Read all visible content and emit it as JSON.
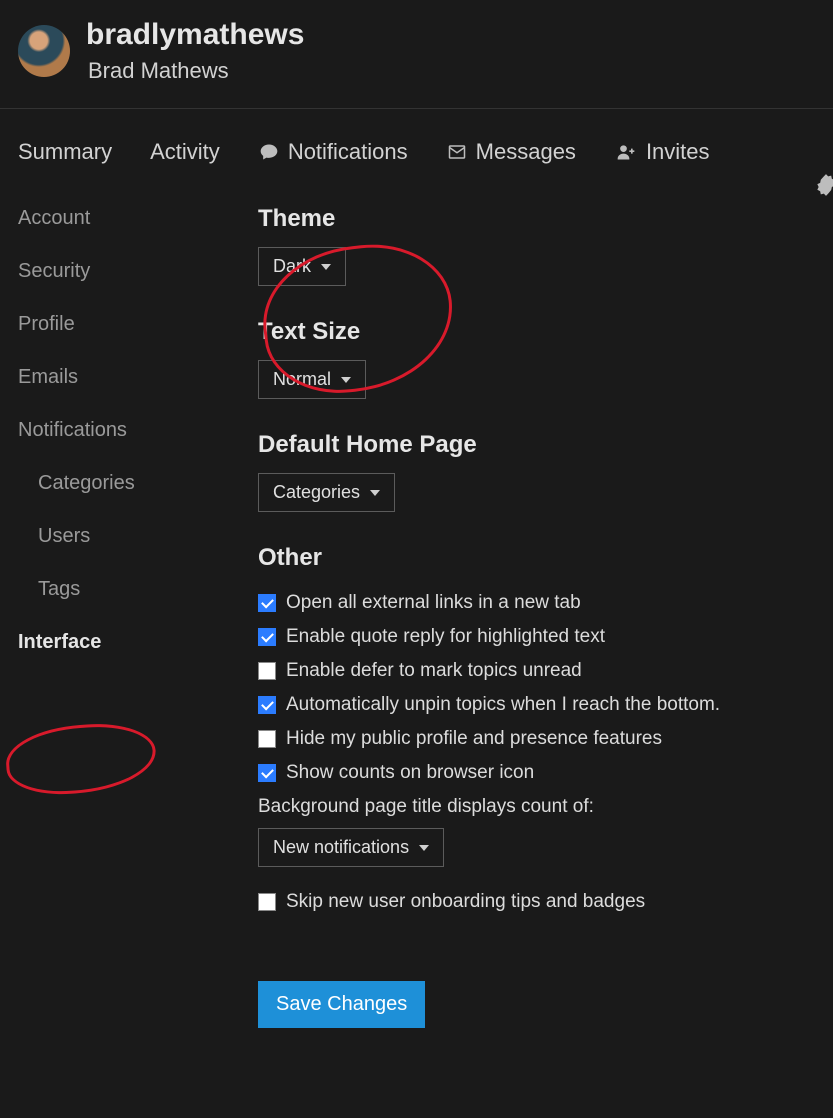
{
  "user": {
    "username": "bradlymathews",
    "fullname": "Brad Mathews"
  },
  "tabs": {
    "summary": "Summary",
    "activity": "Activity",
    "notifications": "Notifications",
    "messages": "Messages",
    "invites": "Invites"
  },
  "sidebar": {
    "account": "Account",
    "security": "Security",
    "profile": "Profile",
    "emails": "Emails",
    "notifications": "Notifications",
    "categories": "Categories",
    "users": "Users",
    "tags": "Tags",
    "interface": "Interface"
  },
  "sections": {
    "theme": {
      "title": "Theme",
      "value": "Dark"
    },
    "textsize": {
      "title": "Text Size",
      "value": "Normal"
    },
    "homepage": {
      "title": "Default Home Page",
      "value": "Categories"
    },
    "other": {
      "title": "Other",
      "ext_links": {
        "label": "Open all external links in a new tab",
        "checked": true
      },
      "quote_reply": {
        "label": "Enable quote reply for highlighted text",
        "checked": true
      },
      "defer": {
        "label": "Enable defer to mark topics unread",
        "checked": false
      },
      "auto_unpin": {
        "label": "Automatically unpin topics when I reach the bottom.",
        "checked": true
      },
      "hide_profile": {
        "label": "Hide my public profile and presence features",
        "checked": false
      },
      "counts_icon": {
        "label": "Show counts on browser icon",
        "checked": true
      },
      "bg_title_label": "Background page title displays count of:",
      "bg_title_value": "New notifications",
      "skip_onboard": {
        "label": "Skip new user onboarding tips and badges",
        "checked": false
      }
    }
  },
  "save_label": "Save Changes"
}
